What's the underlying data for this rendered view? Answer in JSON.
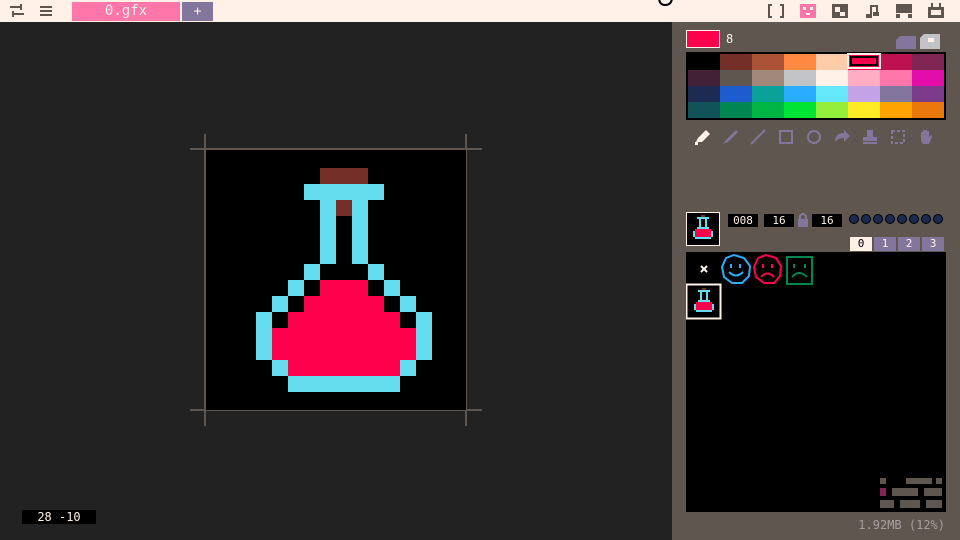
{
  "topbar": {
    "file_tab_label": "0.gfx",
    "add_tab_label": "+"
  },
  "workspace": {
    "cursor_coords": "28 -10"
  },
  "sprite_panel": {
    "current_color_index": "8",
    "sprite_index": "008",
    "sprite_width": "16",
    "sprite_height": "16",
    "page_tabs": [
      "0",
      "1",
      "2",
      "3"
    ],
    "ram_usage": "1.92MB (12%)"
  },
  "colors": {
    "topbar_bg": "#fff1e8",
    "accent_pink": "#ff77a8",
    "selected_color": "#ff004d",
    "panel_bg": "#5f574f",
    "workspace_bg": "#222222",
    "potion_glass": "#66ddee",
    "potion_liquid": "#ff004d",
    "cork": "#742f29"
  },
  "palette": [
    "#000000",
    "#742f29",
    "#ab5236",
    "#ff8843",
    "#ffccaa",
    "#ff004d",
    "#be1250",
    "#7e2553",
    "#422136",
    "#5f574f",
    "#a28879",
    "#c2c3c7",
    "#fff1e8",
    "#ffacc5",
    "#ff77a8",
    "#e40dab",
    "#1d2b53",
    "#1e5bcf",
    "#0aa198",
    "#29adff",
    "#65e8fa",
    "#c3a3e6",
    "#83769c",
    "#7c3a8a",
    "#125359",
    "#008751",
    "#00b543",
    "#00e436",
    "#94ef3d",
    "#ffec27",
    "#ffa300",
    "#e8780c"
  ]
}
